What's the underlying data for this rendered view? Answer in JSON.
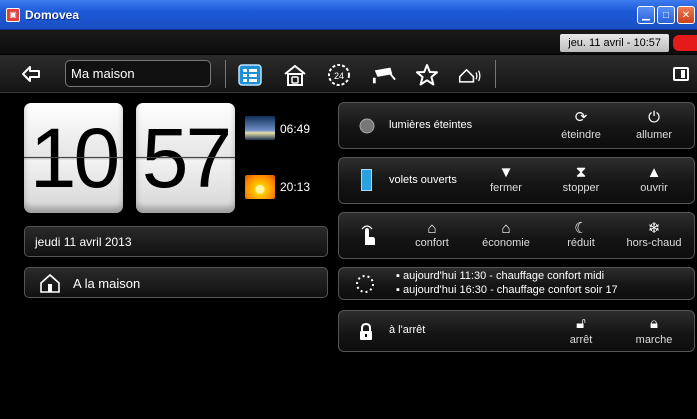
{
  "window": {
    "title": "Domovea"
  },
  "status": {
    "datetime": "jeu. 11 avril - 10:57"
  },
  "toolbar": {
    "house_name": "Ma maison"
  },
  "clock": {
    "hours": "10",
    "minutes": "57",
    "sunrise": "06:49",
    "sunset": "20:13"
  },
  "date_text": "jeudi 11 avril 2013",
  "mode_text": "A la maison",
  "lights": {
    "status": "lumières éteintes",
    "off_label": "éteindre",
    "on_label": "allumer"
  },
  "shutters": {
    "status": "volets ouverts",
    "close_label": "fermer",
    "stop_label": "stopper",
    "open_label": "ouvrir"
  },
  "heating": {
    "confort": "confort",
    "economie": "économie",
    "reduit": "réduit",
    "horsgel": "hors-chaud"
  },
  "schedule": {
    "items": [
      "aujourd'hui 11:30 - chauffage confort midi",
      "aujourd'hui 16:30 - chauffage confort soir 17"
    ]
  },
  "alarm": {
    "status": "à l'arrêt",
    "off_label": "arrêt",
    "on_label": "marche"
  },
  "icons": {
    "back": "arrow-left-icon",
    "view": "list-view-icon",
    "home": "house-icon",
    "timer": "24h-timer-icon",
    "camera": "camera-icon",
    "favorites": "star-icon",
    "alarm": "alarm-house-icon",
    "exit": "exit-icon"
  },
  "colors": {
    "accent_blue": "#1f8fd6",
    "shutter_blue": "#29a3e0",
    "status_red": "#e51b1b"
  }
}
